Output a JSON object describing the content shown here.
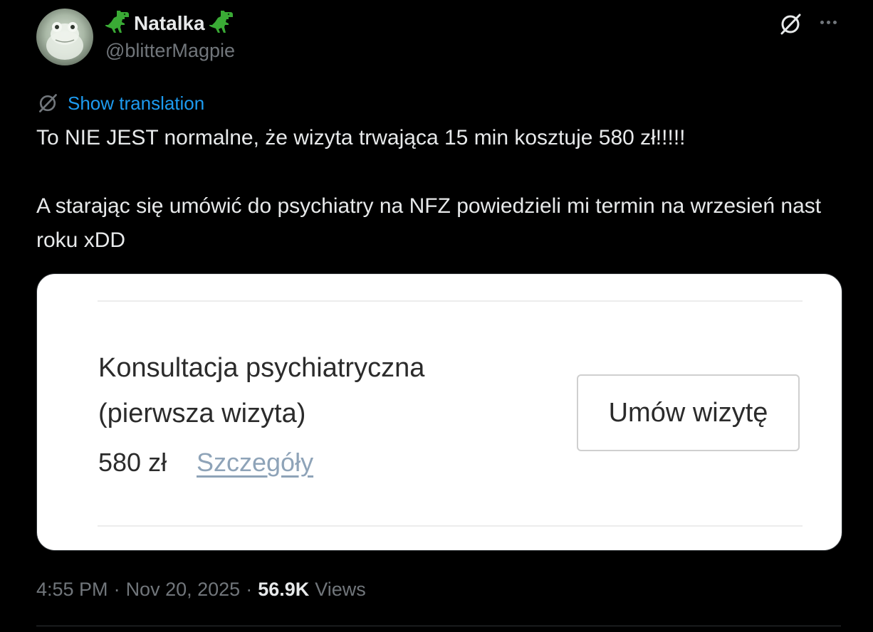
{
  "author": {
    "name": "Natalka",
    "handle": "@blitterMagpie",
    "name_emoji": "t-rex-emoji",
    "avatar": "frog-avatar"
  },
  "header_actions": {
    "grok_icon": "grok-icon",
    "more_icon": "more-icon"
  },
  "translation": {
    "label": "Show translation",
    "icon": "grok-icon"
  },
  "tweet": {
    "paragraphs": [
      "To NIE JEST normalne, że wizyta trwająca 15 min kosztuje 580 zł!!!!!",
      "A starając się umówić do psychiatry na NFZ powiedzieli mi termin na wrzesień nast roku xDD"
    ]
  },
  "media": {
    "service_line1": "Konsultacja psychiatryczna",
    "service_line2": "(pierwsza wizyta)",
    "price": "580 zł",
    "details_link": "Szczegóły",
    "book_button": "Umów wizytę"
  },
  "meta": {
    "time": "4:55 PM",
    "separator": "·",
    "date": "Nov 20, 2025",
    "views_count": "56.9K",
    "views_label": "Views"
  },
  "colors": {
    "background": "#000000",
    "text_primary": "#e7e9ea",
    "text_secondary": "#71767b",
    "link": "#1d9bf0",
    "divider": "#2f3336"
  }
}
